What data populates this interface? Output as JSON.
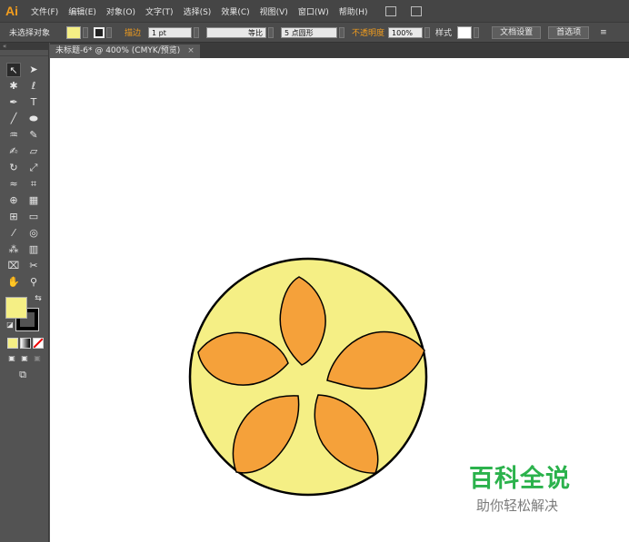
{
  "app": {
    "logo": "Ai"
  },
  "menu": [
    "文件(F)",
    "编辑(E)",
    "对象(O)",
    "文字(T)",
    "选择(S)",
    "效果(C)",
    "视图(V)",
    "窗口(W)",
    "帮助(H)"
  ],
  "control_bar": {
    "selection_label": "未选择对象",
    "stroke_label": "描边",
    "stroke_weight": "1 pt",
    "line_style": "等比",
    "brush": "5 点圆形",
    "opacity_label": "不透明度",
    "opacity_value": "100%",
    "style_label": "样式",
    "doc_setup_button": "文档设置",
    "preferences_button": "首选项"
  },
  "document_tab": {
    "title": "未标题-6* @ 400% (CMYK/预览)",
    "close": "×"
  },
  "colors": {
    "fill": "#f5ef85",
    "petal": "#f5a13a",
    "stroke": "#000000",
    "logo": "#f29d1e",
    "watermark": "#2bb24c"
  },
  "tools": [
    "selection-icon",
    "direct-selection-icon",
    "magic-wand-icon",
    "lasso-icon",
    "pen-icon",
    "type-icon",
    "line-icon",
    "ellipse-icon",
    "paintbrush-icon",
    "pencil-icon",
    "blob-brush-icon",
    "eraser-icon",
    "rotate-icon",
    "scale-icon",
    "width-icon",
    "free-transform-icon",
    "shape-builder-icon",
    "perspective-grid-icon",
    "mesh-icon",
    "gradient-icon",
    "eyedropper-icon",
    "blend-icon",
    "symbol-sprayer-icon",
    "column-graph-icon",
    "artboard-icon",
    "slice-icon",
    "hand-icon",
    "zoom-icon"
  ],
  "watermark": {
    "title": "百科全说",
    "subtitle": "助你轻松解决"
  }
}
